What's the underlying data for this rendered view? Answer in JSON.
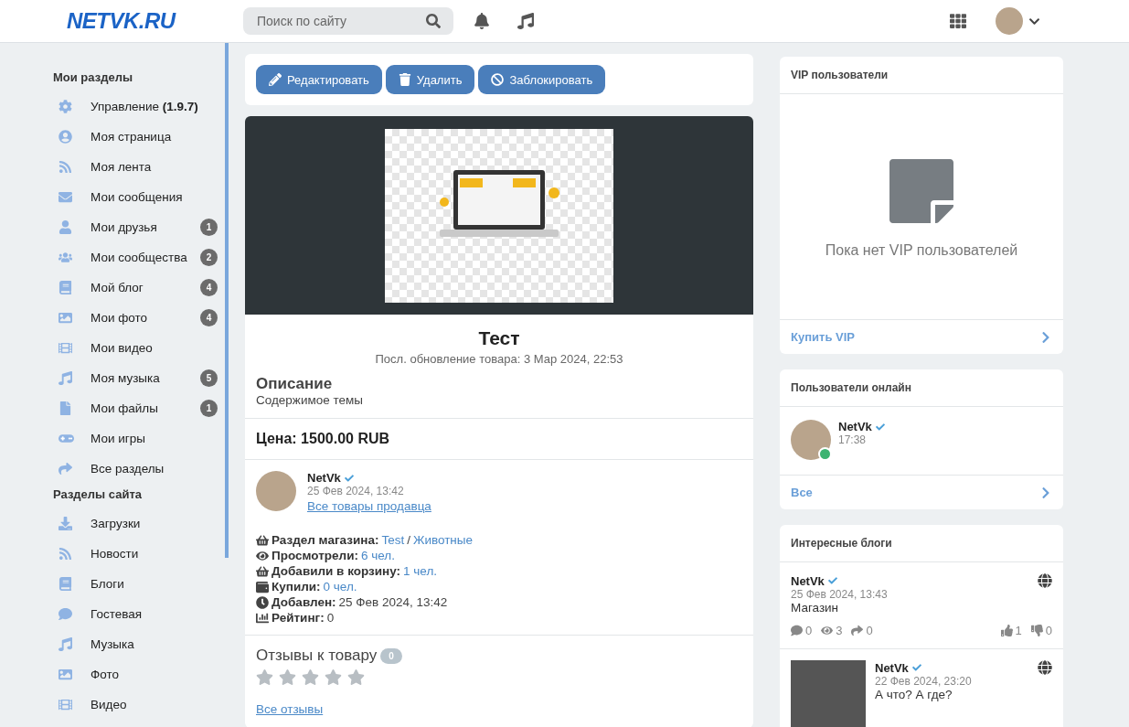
{
  "header": {
    "logo": "NETVK.RU",
    "search": {
      "placeholder": "Поиск по сайту"
    }
  },
  "sidebar": {
    "sections": [
      {
        "title": "Мои разделы",
        "items": [
          {
            "label": "Управление **(1.9.7)**"
          },
          {
            "label": "Моя страница"
          },
          {
            "label": "Моя лента"
          },
          {
            "label": "Мои сообщения"
          },
          {
            "label": "Мои друзья",
            "badge": "1"
          },
          {
            "label": "Мои сообщества",
            "badge": "2"
          },
          {
            "label": "Мой блог",
            "badge": "4"
          },
          {
            "label": "Мои фото",
            "badge": "4"
          },
          {
            "label": "Мои видео"
          },
          {
            "label": "Моя музыка",
            "badge": "5"
          },
          {
            "label": "Мои файлы",
            "badge": "1"
          },
          {
            "label": "Мои игры"
          },
          {
            "label": "Все разделы"
          }
        ]
      },
      {
        "title": "Разделы сайта",
        "items": [
          {
            "label": "Загрузки"
          },
          {
            "label": "Новости"
          },
          {
            "label": "Блоги"
          },
          {
            "label": "Гостевая"
          },
          {
            "label": "Музыка"
          },
          {
            "label": "Фото"
          },
          {
            "label": "Видео"
          }
        ]
      }
    ]
  },
  "actions": [
    "Редактировать",
    "Удалить",
    "Заблокировать"
  ],
  "product": {
    "title": "Тест",
    "updated": "Посл. обновление товара: 3 Мар 2024, 22:53",
    "description_title": "Описание",
    "description": "Содержимое темы",
    "price": "Цена: 1500.00 RUB",
    "seller": {
      "name": "NetVk",
      "date": "25 Фев 2024, 13:42",
      "link": "Все товары продавца"
    },
    "details": [
      {
        "label": "Раздел магазина:",
        "parts": [
          {
            "text": "Test",
            "link": true
          },
          {
            "text": "/",
            "link": false
          },
          {
            "text": "Животные",
            "link": true
          }
        ]
      },
      {
        "label": "Просмотрели:",
        "parts": [
          {
            "text": "6 чел.",
            "link": true
          }
        ]
      },
      {
        "label": "Добавили в корзину:",
        "parts": [
          {
            "text": "1 чел.",
            "link": true
          }
        ]
      },
      {
        "label": "Купили:",
        "parts": [
          {
            "text": "0 чел.",
            "link": true
          }
        ]
      },
      {
        "label": "Добавлен:",
        "parts": [
          {
            "text": "25 Фев 2024, 13:42",
            "link": false
          }
        ]
      },
      {
        "label": "Рейтинг:",
        "parts": [
          {
            "text": "0",
            "link": false
          }
        ]
      }
    ],
    "reviews": {
      "title": "Отзывы к товару",
      "count": "0",
      "stars": 0,
      "link": "Все отзывы"
    }
  },
  "vip": {
    "title": "VIP пользователи",
    "empty": "Пока нет VIP пользователей",
    "link": "Купить VIP"
  },
  "online": {
    "title": "Пользователи онлайн",
    "users": [
      {
        "name": "NetVk",
        "time": "17:38",
        "online": true
      }
    ],
    "link": "Все"
  },
  "blogs": {
    "title": "Интересные блоги",
    "items": [
      {
        "name": "NetVk",
        "date": "25 Фев 2024, 13:43",
        "text": "Магазин",
        "photo": false,
        "stats": {
          "comments": "0",
          "views": "3",
          "shares": "0",
          "likes": "1",
          "dislikes": "0"
        }
      },
      {
        "name": "NetVk",
        "date": "22 Фев 2024, 23:20",
        "text": "А что? А где?",
        "photo": true
      }
    ]
  }
}
